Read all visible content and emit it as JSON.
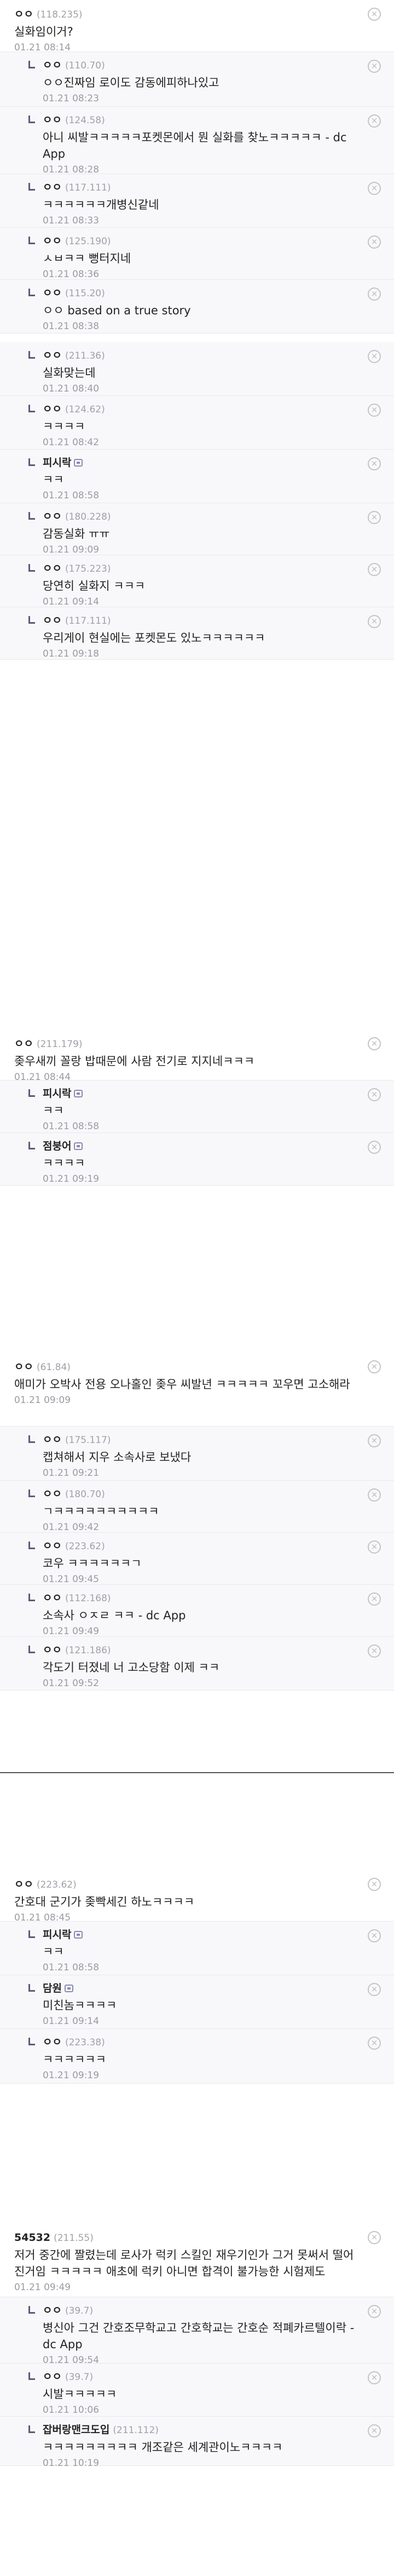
{
  "threads": [
    {
      "top": {
        "nick": "ㅇㅇ",
        "ip": "(118.235)",
        "text": "실화임이거?",
        "date": "01.21 08:14"
      },
      "replies": [
        {
          "nick": "ㅇㅇ",
          "ip": "(110.70)",
          "text": "ㅇㅇ진짜임 로이도 감동에피하나있고",
          "date": "01.21 08:23"
        },
        {
          "nick": "ㅇㅇ",
          "ip": "(124.58)",
          "text": "아니 씨발ㅋㅋㅋㅋㅋ포켓몬에서 뭔 실화를 찾노ㅋㅋㅋㅋㅋ - dc App",
          "date": "01.21 08:28"
        },
        {
          "nick": "ㅇㅇ",
          "ip": "(117.111)",
          "text": "ㅋㅋㅋㅋㅋㅋ개병신같네",
          "date": "01.21 08:33"
        },
        {
          "nick": "ㅇㅇ",
          "ip": "(125.190)",
          "text": "ㅅㅂㅋㅋ 뻥터지네",
          "date": "01.21 08:36"
        },
        {
          "nick": "ㅇㅇ",
          "ip": "(115.20)",
          "text": "ㅇㅇ based on a true story",
          "date": "01.21 08:38"
        },
        {
          "nick": "ㅇㅇ",
          "ip": "(211.36)",
          "text": "실화맞는데",
          "date": "01.21 08:40"
        },
        {
          "nick": "ㅇㅇ",
          "ip": "(124.62)",
          "text": "ㅋㅋㅋㅋ",
          "date": "01.21 08:42"
        },
        {
          "nick": "피시락",
          "ip": "",
          "fix": true,
          "text": "ㅋㅋ",
          "date": "01.21 08:58"
        },
        {
          "nick": "ㅇㅇ",
          "ip": "(180.228)",
          "text": "감동실화 ㅠㅠ",
          "date": "01.21 09:09"
        },
        {
          "nick": "ㅇㅇ",
          "ip": "(175.223)",
          "text": "당연히 실화지 ㅋㅋㅋ",
          "date": "01.21 09:14"
        },
        {
          "nick": "ㅇㅇ",
          "ip": "(117.111)",
          "text": "우리게이 현실에는 포켓몬도 있노ㅋㅋㅋㅋㅋㅋ",
          "date": "01.21 09:18"
        }
      ]
    },
    {
      "top": {
        "nick": "ㅇㅇ",
        "ip": "(211.179)",
        "text": "좆우새끼 꼴랑 밥때문에 사람 전기로 지지네ㅋㅋㅋ",
        "date": "01.21 08:44"
      },
      "replies": [
        {
          "nick": "피시락",
          "ip": "",
          "fix": true,
          "text": "ㅋㅋ",
          "date": "01.21 08:58"
        },
        {
          "nick": "점붕어",
          "ip": "",
          "fix": true,
          "text": "ㅋㅋㅋㅋ",
          "date": "01.21 09:19"
        }
      ]
    },
    {
      "top": {
        "nick": "ㅇㅇ",
        "ip": "(61.84)",
        "text": "애미가 오박사 전용 오나홀인 좆우 씨발년 ㅋㅋㅋㅋㅋ 꼬우면 고소해라",
        "date": "01.21 09:09"
      },
      "replies": [
        {
          "nick": "ㅇㅇ",
          "ip": "(175.117)",
          "text": "캡쳐해서 지우 소속사로 보냈다",
          "date": "01.21 09:21"
        },
        {
          "nick": "ㅇㅇ",
          "ip": "(180.70)",
          "text": "ㄱㅋㅋㅋㅋㅋㅋㅋㅋㅋㅋ",
          "date": "01.21 09:42"
        },
        {
          "nick": "ㅇㅇ",
          "ip": "(223.62)",
          "text": "코우 ㅋㅋㅋㅋㅋㅋㄱ",
          "date": "01.21 09:45"
        },
        {
          "nick": "ㅇㅇ",
          "ip": "(112.168)",
          "text": "소속사 ㅇㅈㄹ ㅋㅋ - dc App",
          "date": "01.21 09:49"
        },
        {
          "nick": "ㅇㅇ",
          "ip": "(121.186)",
          "text": "각도기 터졌네 너 고소당함 이제 ㅋㅋ",
          "date": "01.21 09:52"
        }
      ]
    },
    {
      "top": {
        "nick": "ㅇㅇ",
        "ip": "(223.62)",
        "text": "간호대 군기가 좆빡세긴 하노ㅋㅋㅋㅋ",
        "date": "01.21 08:45"
      },
      "replies": [
        {
          "nick": "피시락",
          "ip": "",
          "fix": true,
          "text": "ㅋㅋ",
          "date": "01.21 08:58"
        },
        {
          "nick": "담원",
          "ip": "",
          "fix": true,
          "text": "미친놈ㅋㅋㅋㅋ",
          "date": "01.21 09:14"
        },
        {
          "nick": "ㅇㅇ",
          "ip": "(223.38)",
          "text": "ㅋㅋㅋㅋㅋㅋ",
          "date": "01.21 09:19"
        }
      ]
    },
    {
      "top": {
        "nick": "54532",
        "ip": "(211.55)",
        "text": "저거 중간에 짤렸는데 로사가 럭키 스킬인 재우기인가 그거 못써서 떨어진거임 ㅋㅋㅋㅋㅋ 애초에 럭키 아니면 합격이 불가능한 시험제도",
        "date": "01.21 09:49"
      },
      "replies": [
        {
          "nick": "ㅇㅇ",
          "ip": "(39.7)",
          "text": "병신아 그건 간호조무학교고 간호학교는 간호순 적폐카르텔이락 - dc App",
          "date": "01.21 09:54"
        },
        {
          "nick": "ㅇㅇ",
          "ip": "(39.7)",
          "text": "시발ㅋㅋㅋㅋㅋ",
          "date": "01.21 10:06"
        },
        {
          "nick": "잡버랑맨크도입",
          "ip": "(211.112)",
          "text": "ㅋㅋㅋㅋㅋㅋㅋㅋㅋ 개조같은 세계관이노ㅋㅋㅋㅋ",
          "date": "01.21 10:19"
        }
      ]
    }
  ],
  "icons": {
    "delete": "close-circle-icon",
    "reply": "reply-arrow-icon",
    "fixed_nick": "fixed-nick-icon"
  },
  "colors": {
    "reply_bg": "#f8f8fa",
    "ip": "#a0a0a8",
    "arrow": "#5b5b7a"
  }
}
